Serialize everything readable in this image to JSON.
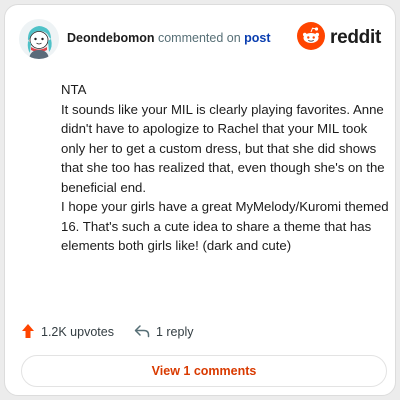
{
  "comment": {
    "username": "Deondebomon",
    "action_text": "commented on",
    "post_link": "post",
    "paragraphs": [
      "NTA",
      "It sounds like your MIL is clearly playing favorites. Anne didn't have to apologize to Rachel that your MIL took only her to get a custom dress, but that she did shows that she too has realized that, even though she's on the beneficial end.",
      "I hope your girls have a great MyMelody/Kuromi themed 16. That's such a cute idea to share a theme that has elements both girls like! (dark and cute)"
    ]
  },
  "brand": {
    "name": "reddit",
    "accent": "#ff4500"
  },
  "actions": {
    "upvotes": "1.2K upvotes",
    "reply": "1 reply"
  },
  "view_comments_label": "View 1 comments",
  "icons": [
    "avatar",
    "reddit-logo-icon",
    "upvote-arrow-icon",
    "reply-arrow-icon"
  ]
}
